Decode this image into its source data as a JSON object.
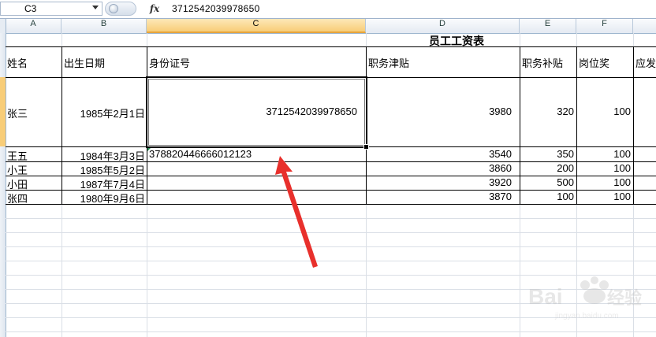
{
  "formula_bar": {
    "name_box": "C3",
    "fx_label": "fx",
    "content": "3712542039978650"
  },
  "columns": [
    "A",
    "B",
    "C",
    "D",
    "E",
    "F"
  ],
  "sheet": {
    "title": "员工工资表",
    "headers": [
      "姓名",
      "出生日期",
      "身份证号",
      "职务津贴",
      "职务补贴",
      "岗位奖",
      "应发"
    ],
    "rows": [
      [
        "张三",
        "1985年2月1日",
        "3712542039978650",
        "3980",
        "320",
        "100"
      ],
      [
        "王五",
        "1984年3月3日",
        "378820446666012123",
        "3540",
        "350",
        "100"
      ],
      [
        "小王",
        "1985年5月2日",
        "",
        "3860",
        "200",
        "100"
      ],
      [
        "小田",
        "1987年7月4日",
        "",
        "3920",
        "500",
        "100"
      ],
      [
        "张四",
        "1980年9月6日",
        "",
        "3870",
        "100",
        "100"
      ]
    ]
  },
  "annotation": {
    "arrow_color": "#e8302c"
  },
  "watermark": {
    "logo": "Baidu经验",
    "url": "jingyan.baidu.com"
  },
  "colors": {
    "selected_header": "#f8cd78",
    "grid_line": "#dadfe6"
  }
}
